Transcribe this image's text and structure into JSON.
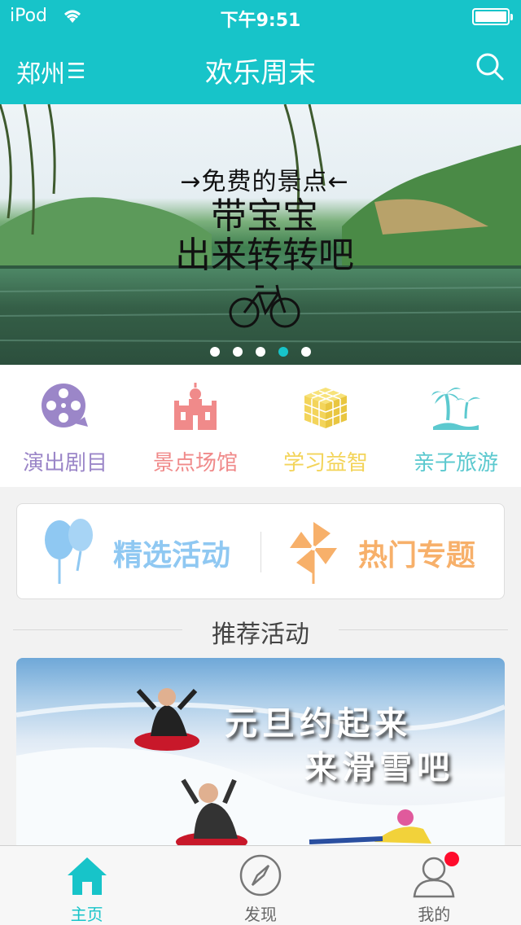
{
  "status_bar": {
    "carrier": "iPod",
    "time": "下午9:51"
  },
  "navbar": {
    "city": "郑州",
    "menu_glyph": "☰",
    "title": "欢乐周末",
    "search_icon": "search-icon"
  },
  "banner": {
    "line1": "→免费的景点←",
    "line2": "带宝宝",
    "line3": "出来转转吧",
    "page_count": 5,
    "active_page": 4
  },
  "categories": [
    {
      "label": "演出剧目",
      "icon": "film-reel-icon",
      "color": "#9b86c8"
    },
    {
      "label": "景点场馆",
      "icon": "castle-icon",
      "color": "#f08a8a"
    },
    {
      "label": "学习益智",
      "icon": "rubiks-cube-icon",
      "color": "#f3d45a"
    },
    {
      "label": "亲子旅游",
      "icon": "palm-tree-icon",
      "color": "#5cc9cf"
    }
  ],
  "featured": [
    {
      "label": "精选活动",
      "icon": "balloons-icon",
      "color": "#8fc8f2"
    },
    {
      "label": "热门专题",
      "icon": "pinwheel-icon",
      "color": "#f7b06a"
    }
  ],
  "section_title": "推荐活动",
  "activity": {
    "caption1": "元旦约起来",
    "caption2": "来滑雪吧"
  },
  "tabbar": {
    "items": [
      {
        "label": "主页",
        "icon": "home-icon",
        "active": true
      },
      {
        "label": "发现",
        "icon": "compass-icon",
        "active": false
      },
      {
        "label": "我的",
        "icon": "user-icon",
        "active": false
      }
    ]
  },
  "colors": {
    "accent": "#17c4c9",
    "badge": "#ff0c2c"
  }
}
